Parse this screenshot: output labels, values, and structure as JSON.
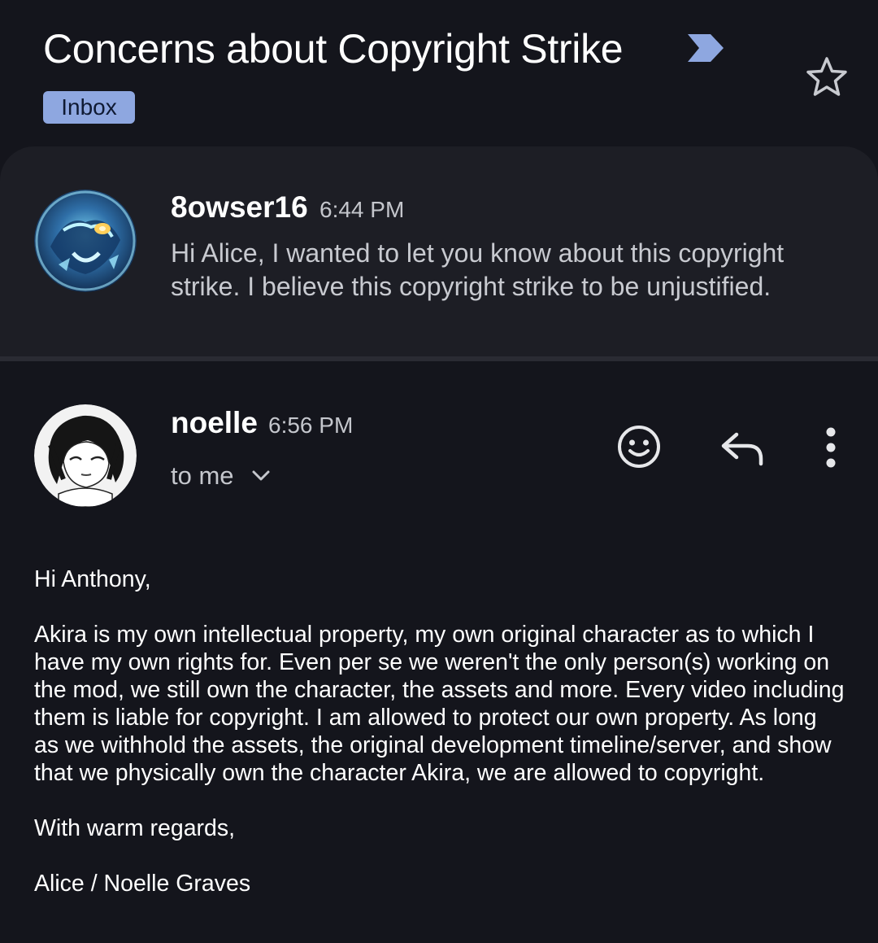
{
  "thread": {
    "subject": "Concerns about Copyright Strike",
    "label": "Inbox"
  },
  "messages": [
    {
      "sender": "8owser16",
      "time": "6:44 PM",
      "snippet": "Hi Alice, I wanted to let you know about this copyright strike. I believe this copyright strike to be unjustified."
    },
    {
      "sender": "noelle",
      "time": "6:56 PM",
      "recipient": "to me",
      "body": {
        "greeting": "Hi Anthony,",
        "paragraph": "Akira is my own intellectual property, my own original character as to which I have my own rights for. Even per se we weren't the only person(s) working on the mod, we still own the character, the assets and more. Every video including them is liable for copyright. I am allowed to protect our own property. As long as we withhold the assets, the original development timeline/server, and show that we physically own the character Akira, we are allowed to copyright.",
        "closing": "With warm regards,",
        "signature": "Alice / Noelle Graves"
      }
    }
  ],
  "colors": {
    "background": "#14151c",
    "card": "#1d1e25",
    "chip": "#8ea7e0",
    "importance": "#8ea7e0"
  },
  "icons": {
    "importance": "importance-marker-icon",
    "star": "star-outline-icon",
    "emoji": "add-reaction-icon",
    "reply": "reply-icon",
    "more": "more-vert-icon",
    "expand": "chevron-down-icon"
  }
}
